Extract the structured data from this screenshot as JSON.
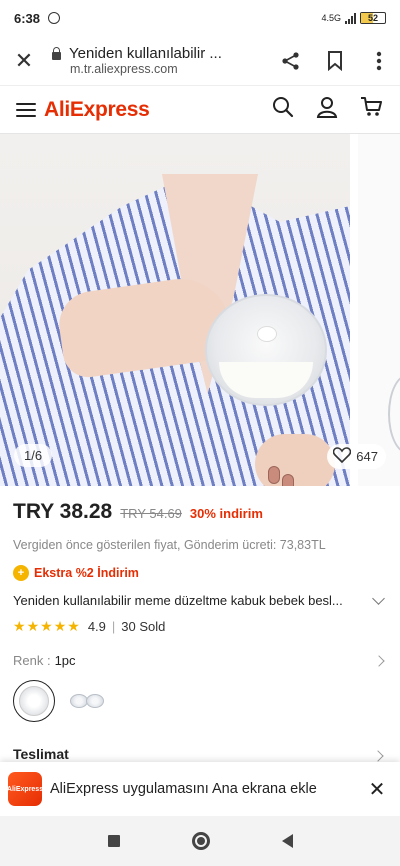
{
  "status_bar": {
    "time": "6:38",
    "network": "4.5G",
    "battery": "52"
  },
  "browser": {
    "page_title": "Yeniden kullanılabilir ...",
    "url": "m.tr.aliexpress.com"
  },
  "header": {
    "logo": "AliExpress"
  },
  "gallery": {
    "counter": "1/6",
    "wishlist_count": "647"
  },
  "product": {
    "price": "TRY 38.28",
    "old_price": "TRY 54.69",
    "discount": "30% indirim",
    "tax_note": "Vergiden önce gösterilen fiyat, Gönderim ücreti: 73,83TL",
    "extra_discount": "Ekstra %2 İndirim",
    "title": "Yeniden kullanılabilir meme düzeltme kabuk bebek besl...",
    "rating": "4.9",
    "sold": "30 Sold",
    "rating_stars": 5,
    "spec_label": "Renk :",
    "spec_value": "1pc",
    "shipping_label": "Teslimat"
  },
  "banner": {
    "app_icon_text": "AliExpress",
    "text": "AliExpress uygulamasını Ana ekrana ekle"
  },
  "colors": {
    "accent": "#e62e04",
    "star": "#f5b400"
  }
}
